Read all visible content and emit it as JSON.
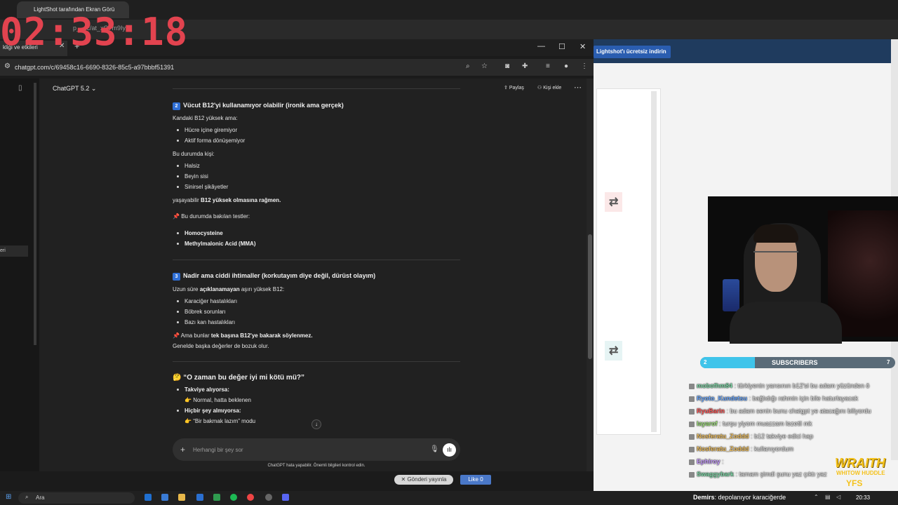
{
  "timer": "02:33:18",
  "background_browser": {
    "tab_title": "LightShot tarafından Ekran Görü",
    "url_fragment": "p__sc/at_xG7m9IyG",
    "lightshot_button": "Lightshot'ı ücretsiz indirin"
  },
  "window": {
    "tab_title": "kliği ve etkileri",
    "url": "chatgpt.com/c/69458c16-6690-8326-85c5-a97bbbf51391"
  },
  "chatgpt": {
    "model_label": "ChatGPT 5.2",
    "share_label": "Paylaş",
    "add_person_label": "Kişi ekle",
    "sidebar_stub": "eri",
    "section2": {
      "number": "2",
      "title": "Vücut B12'yi kullanamıyor olabilir (ironik ama gerçek)",
      "intro": "Kandaki B12 yüksek ama:",
      "bullets1": [
        "Hücre içine giremiyor",
        "Aktif forma dönüşemiyor"
      ],
      "intro2": "Bu durumda kişi:",
      "bullets2": [
        "Halsiz",
        "Beyin sisi",
        "Sinirsel şikâyetler"
      ],
      "conclusion_pre": "yaşayabilir ",
      "conclusion_bold": "B12 yüksek olmasına rağmen.",
      "tests_label": "Bu durumda bakılan testler:",
      "tests": [
        "Homocysteine",
        "Methylmalonic Acid (MMA)"
      ]
    },
    "section3": {
      "number": "3",
      "title": "Nadir ama ciddi ihtimaller (korkutayım diye değil, dürüst olayım)",
      "intro_pre": "Uzun süre ",
      "intro_bold": "açıklanamayan",
      "intro_post": " aşırı yüksek B12:",
      "bullets": [
        "Karaciğer hastalıkları",
        "Böbrek sorunları",
        "Bazı kan hastalıkları"
      ],
      "note_pre": "Ama bunlar ",
      "note_bold": "tek başına B12'ye bakarak söylenmez.",
      "note2": "Genelde başka değerler de bozuk olur."
    },
    "section4": {
      "title": "“O zaman bu değer iyi mi kötü mü?”",
      "item1_label": "Takviye alıyorsa:",
      "item1_value": "Normal, hatta beklenen",
      "item2_label": "Hiçbir şey almıyorsa:",
      "item2_value": "“Bir bakmak lazım” modu"
    },
    "input_placeholder": "Herhangi bir şey sor",
    "disclaimer": "ChatGPT hata yapabilir. Önemli bilgileri kontrol edin."
  },
  "stream": {
    "subscribers_count": "2",
    "subscribers_label": "SUBSCRIBERS",
    "subscribers_goal": "7",
    "subscribers_progress": 0.28,
    "chat": [
      {
        "user": "mobofhm84",
        "color": "#7fd9a8",
        "message": "türkiyenin yarısının b12'si bu adam yüzünden ö"
      },
      {
        "user": "Ryoto_Kundetsu",
        "color": "#6aa8ff",
        "message": "bağlıdığı rahmin için bile haturlayacak"
      },
      {
        "user": "RyuBarin",
        "color": "#ff5a5a",
        "message": "bu adam senin bunu chatgpt ye atacağını biliyordu"
      },
      {
        "user": "layarof",
        "color": "#9fe27a",
        "message": "turşu yiyom muazzam lezetli mk"
      },
      {
        "user": "Nosferatu_Zoddd",
        "color": "#f0c060",
        "message": "b12 takviye edici hap"
      },
      {
        "user": "Nosferatu_Zoddd",
        "color": "#f0c060",
        "message": "kullanıyordum"
      },
      {
        "user": "Ephiroy",
        "color": "#c79bff",
        "message": ""
      },
      {
        "user": "Swaggybark",
        "color": "#7fd9a8",
        "message": "tamam şimdi şunu yaz çıktı yaz"
      }
    ],
    "wraith_title": "WRAITH",
    "wraith_sub": "WHITOW HUDDLE",
    "wraith_tag": "YFS",
    "send_button": "Gönderi yayınla",
    "like_button": "Like 0"
  },
  "taskbar": {
    "search_placeholder": "Ara",
    "ticker_user": "Demirs",
    "ticker_message": ": depolanıyor karaciğerde",
    "time": "20:33"
  }
}
